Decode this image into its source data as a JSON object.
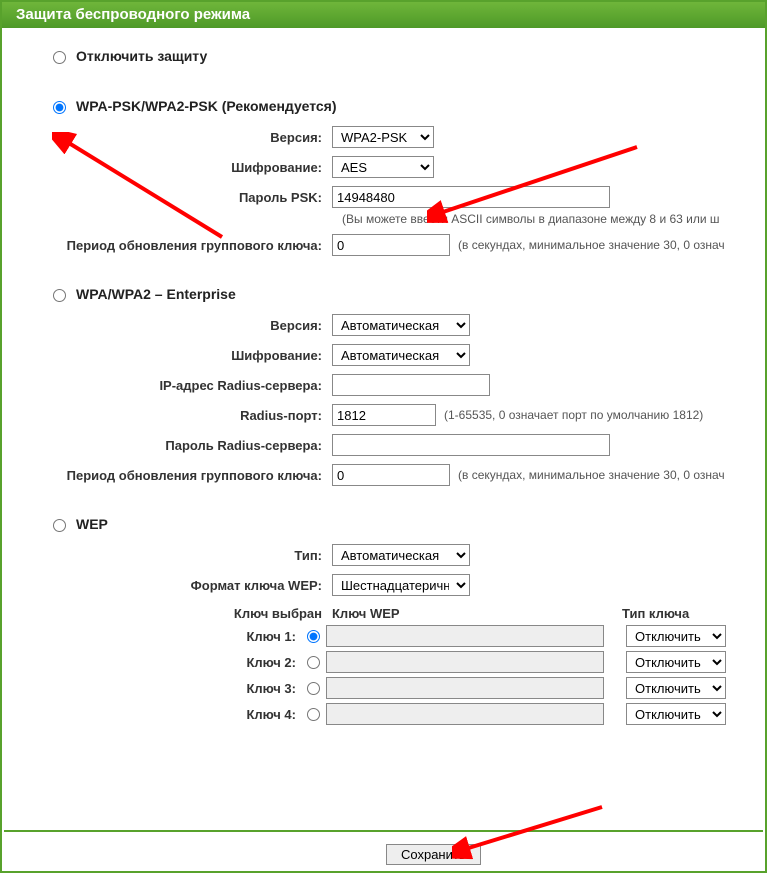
{
  "title": "Защита беспроводного режима",
  "sections": {
    "disable": {
      "label": "Отключить защиту"
    },
    "wpa_psk": {
      "label": "WPA-PSK/WPA2-PSK (Рекомендуется)",
      "version_label": "Версия:",
      "version_value": "WPA2-PSK",
      "encryption_label": "Шифрование:",
      "encryption_value": "AES",
      "psk_label": "Пароль PSK:",
      "psk_value": "14948480",
      "psk_hint": "(Вы можете ввести ASCII символы в диапазоне между 8 и 63 или ш",
      "gk_label": "Период обновления группового ключа:",
      "gk_value": "0",
      "gk_hint": "(в секундах, минимальное значение 30, 0 означ"
    },
    "wpa_ent": {
      "label": "WPA/WPA2 – Enterprise",
      "version_label": "Версия:",
      "version_value": "Автоматическая",
      "encryption_label": "Шифрование:",
      "encryption_value": "Автоматическая",
      "radius_ip_label": "IP-адрес Radius-сервера:",
      "radius_ip_value": "",
      "radius_port_label": "Radius-порт:",
      "radius_port_value": "1812",
      "radius_port_hint": "(1-65535, 0 означает порт по умолчанию 1812)",
      "radius_pw_label": "Пароль Radius-сервера:",
      "radius_pw_value": "",
      "gk_label": "Период обновления группового ключа:",
      "gk_value": "0",
      "gk_hint": "(в секундах, минимальное значение 30, 0 означ"
    },
    "wep": {
      "label": "WEP",
      "type_label": "Тип:",
      "type_value": "Автоматическая",
      "format_label": "Формат ключа WEP:",
      "format_value": "Шестнадцатеричный",
      "col_selected": "Ключ выбран",
      "col_key": "Ключ WEP",
      "col_keytype": "Тип ключа",
      "keys": [
        {
          "label": "Ключ 1:",
          "value": "",
          "type": "Отключить"
        },
        {
          "label": "Ключ 2:",
          "value": "",
          "type": "Отключить"
        },
        {
          "label": "Ключ 3:",
          "value": "",
          "type": "Отключить"
        },
        {
          "label": "Ключ 4:",
          "value": "",
          "type": "Отключить"
        }
      ]
    }
  },
  "save_label": "Сохранить"
}
